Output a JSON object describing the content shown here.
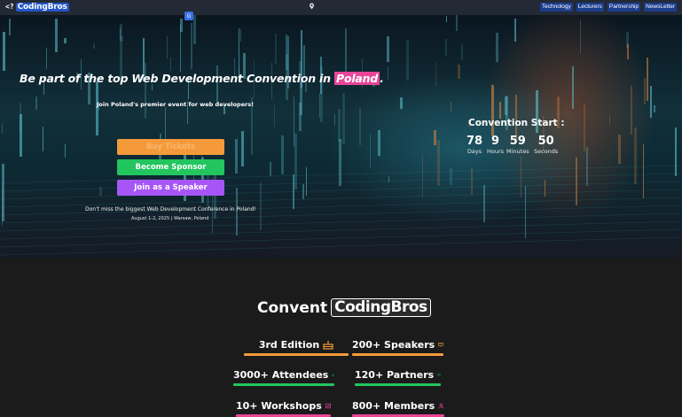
{
  "nav": {
    "logo_mark": "<?",
    "logo_text": "CodingBros",
    "links": [
      "Technology",
      "Lecturers",
      "Partnership",
      "NewsLetter"
    ]
  },
  "translate_glyph": "G",
  "hero": {
    "title_prefix": "Be part of the top Web Development Convention in ",
    "title_highlight": "Poland",
    "title_suffix": ".",
    "subtitle": "Join Poland's premier event for web developers!",
    "buttons": {
      "tickets": "Buy Tickets",
      "sponsor": "Become Sponsor",
      "speaker": "Join as a Speaker"
    },
    "note": "Don't miss the biggest Web Development Conference in Poland!",
    "date": "August 1-2, 2025 | Warsaw, Poland"
  },
  "countdown": {
    "title": "Convention Start :",
    "units": [
      {
        "value": "78",
        "label": "Days"
      },
      {
        "value": "9",
        "label": "Hours"
      },
      {
        "value": "59",
        "label": "Minutes"
      },
      {
        "value": "50",
        "label": "Seconds"
      }
    ]
  },
  "stats_section": {
    "title_word": "Convent",
    "title_brand": "CodingBros",
    "items": [
      {
        "num": "3rd",
        "label": "Edition",
        "icon": "cake-icon",
        "color": "#f59a3a"
      },
      {
        "num": "200+",
        "label": "Speakers",
        "icon": "presentation-icon",
        "color": "#f59a3a"
      },
      {
        "num": "3000+",
        "label": "Attendees",
        "icon": "users-icon",
        "color": "#22c55e"
      },
      {
        "num": "120+",
        "label": "Partners",
        "icon": "handshake-icon",
        "color": "#22c55e"
      },
      {
        "num": "10+",
        "label": "Workshops",
        "icon": "chart-icon",
        "color": "#e8459a"
      },
      {
        "num": "800+",
        "label": "Members",
        "icon": "user-icon",
        "color": "#e8459a"
      }
    ]
  },
  "colors": {
    "nav_bg": "#232a35",
    "nav_link_bg": "#1b3d8c",
    "highlight": "#e8459a",
    "orange": "#f59a3a",
    "green": "#22c55e",
    "purple": "#a855f7",
    "section_bg": "#1b1b1b"
  }
}
